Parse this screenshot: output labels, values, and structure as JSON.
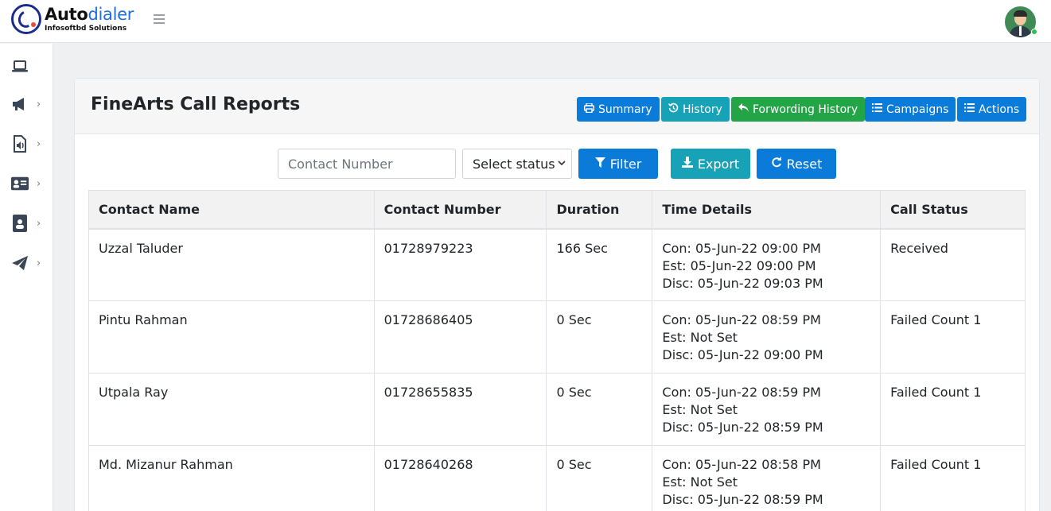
{
  "app": {
    "logo_main": "Auto",
    "logo_accent": "dialer",
    "logo_sub": "Infosoftbd Solutions"
  },
  "sidebar": {
    "items": [
      {
        "icon": "laptop-icon",
        "has_chevron": false
      },
      {
        "icon": "megaphone-icon",
        "has_chevron": true
      },
      {
        "icon": "audio-file-icon",
        "has_chevron": true
      },
      {
        "icon": "id-card-icon",
        "has_chevron": true
      },
      {
        "icon": "contact-book-icon",
        "has_chevron": true
      },
      {
        "icon": "paper-plane-icon",
        "has_chevron": true
      }
    ],
    "chevron": "›"
  },
  "card": {
    "title": "FineArts Call Reports",
    "buttons": {
      "summary": "Summary",
      "history": "History",
      "forwarding_history": "Forwording History",
      "campaigns": "Campaigns",
      "actions": "Actions"
    }
  },
  "filters": {
    "contact_placeholder": "Contact Number",
    "status_selected": "Select status",
    "filter_label": "Filter",
    "export_label": "Export",
    "reset_label": "Reset"
  },
  "table": {
    "headers": [
      "Contact Name",
      "Contact Number",
      "Duration",
      "Time Details",
      "Call Status"
    ],
    "rows": [
      {
        "name": "Uzzal Taluder",
        "number": "01728979223",
        "duration": "166 Sec",
        "con": "Con: 05-Jun-22 09:00 PM",
        "est": "Est: 05-Jun-22 09:00 PM",
        "disc": "Disc: 05-Jun-22 09:03 PM",
        "status": "Received"
      },
      {
        "name": "Pintu Rahman",
        "number": "01728686405",
        "duration": "0 Sec",
        "con": "Con: 05-Jun-22 08:59 PM",
        "est": "Est: Not Set",
        "disc": "Disc: 05-Jun-22 09:00 PM",
        "status": "Failed Count 1"
      },
      {
        "name": "Utpala Ray",
        "number": "01728655835",
        "duration": "0 Sec",
        "con": "Con: 05-Jun-22 08:59 PM",
        "est": "Est: Not Set",
        "disc": "Disc: 05-Jun-22 08:59 PM",
        "status": "Failed Count 1"
      },
      {
        "name": "Md. Mizanur Rahman",
        "number": "01728640268",
        "duration": "0 Sec",
        "con": "Con: 05-Jun-22 08:58 PM",
        "est": "Est: Not Set",
        "disc": "Disc: 05-Jun-22 08:59 PM",
        "status": "Failed Count 1"
      }
    ]
  },
  "colors": {
    "primary": "#0a7bd8",
    "info": "#17a2b8",
    "success": "#22a447"
  }
}
